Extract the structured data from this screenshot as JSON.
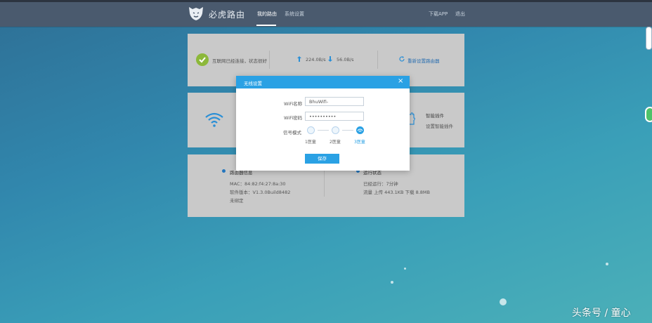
{
  "header": {
    "brand": "必虎路由",
    "nav": [
      "我的路由",
      "系统设置"
    ],
    "right_links": [
      "下载APP",
      "退出"
    ]
  },
  "status_card": {
    "internet_status": "互联网已经连接，状态很好",
    "upload_speed": "224.0B/s",
    "download_speed": "56.0B/s",
    "reset_link": "重新设置路由器"
  },
  "plugin_card": {
    "title": "智能插件",
    "subtitle": "设置智能插件"
  },
  "info_card": {
    "router_info_title": "路由器信息",
    "mac": "MAC：84:82:f4:27:8a:30",
    "firmware": "软件版本：V1.3.0Build8482",
    "binding": "未绑定",
    "run_status_title": "运行状态",
    "uptime": "已经运行：7分钟",
    "traffic": "流量 上传 443.1KB 下载 8.8MB"
  },
  "dialog": {
    "title": "无线设置",
    "close_glyph": "×",
    "ssid_label": "WiFi名称",
    "ssid_value": "BhuWifi-",
    "password_label": "WiFi密码",
    "password_value": "••••••••••",
    "signal_label": "信号模式",
    "signal_options": [
      "1医童",
      "2医童",
      "3医童"
    ],
    "signal_selected_index": 2,
    "save_label": "保存"
  },
  "watermark": "头条号 / 童心",
  "colors": {
    "accent": "#2aa1e4",
    "topbar": "#4a5a6e",
    "ok_green": "#8cb83a",
    "card_gray": "#c9c9c9"
  },
  "icons": [
    "tiger-logo-icon",
    "check-icon",
    "upload-arrow-icon",
    "download-arrow-icon",
    "refresh-icon",
    "wifi-icon",
    "puzzle-icon",
    "close-icon",
    "signal-icon"
  ]
}
